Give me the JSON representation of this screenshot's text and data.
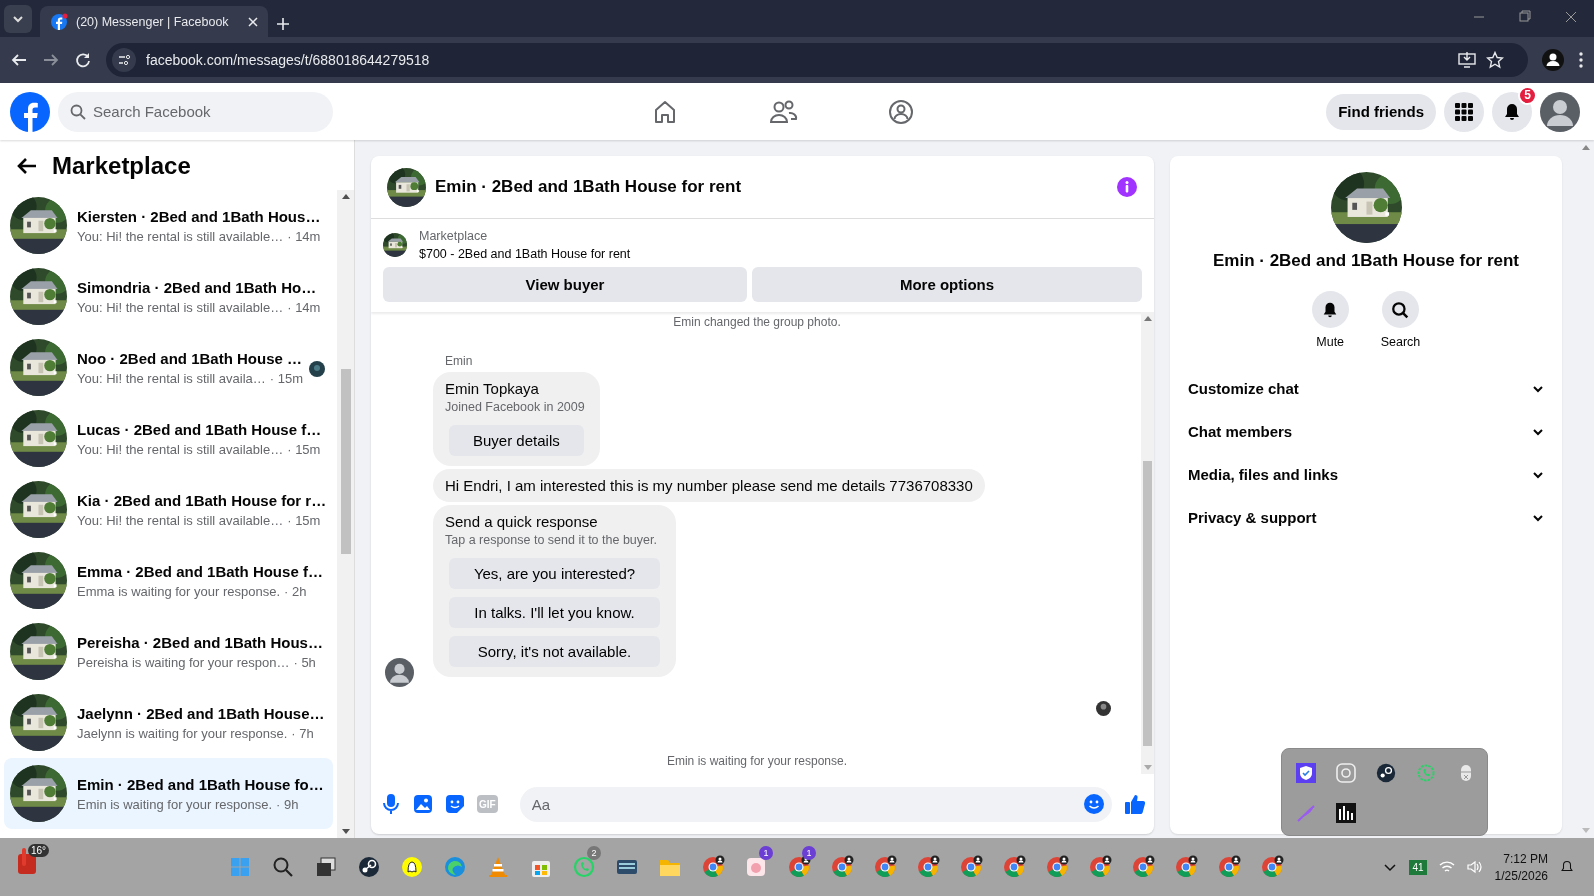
{
  "browser": {
    "tab_title": "(20) Messenger | Facebook",
    "url": "facebook.com/messages/t/688018644279518"
  },
  "header": {
    "search_placeholder": "Search Facebook",
    "find_friends": "Find friends",
    "notification_count": "5"
  },
  "sidebar": {
    "title": "Marketplace",
    "chats": [
      {
        "title": "Kiersten · 2Bed and 1Bath Hous…",
        "preview": "You: Hi! the rental is still available…",
        "time": "· 14m",
        "selected": false,
        "seen": false
      },
      {
        "title": "Simondria · 2Bed and 1Bath Ho…",
        "preview": "You: Hi! the rental is still available…",
        "time": "· 14m",
        "selected": false,
        "seen": false
      },
      {
        "title": "Noo · 2Bed and 1Bath House …",
        "preview": "You: Hi! the rental is still availa…",
        "time": "· 15m",
        "selected": false,
        "seen": true
      },
      {
        "title": "Lucas · 2Bed and 1Bath House f…",
        "preview": "You: Hi! the rental is still available…",
        "time": "· 15m",
        "selected": false,
        "seen": false
      },
      {
        "title": "Kia · 2Bed and 1Bath House for r…",
        "preview": "You: Hi! the rental is still available…",
        "time": "· 15m",
        "selected": false,
        "seen": false
      },
      {
        "title": "Emma · 2Bed and 1Bath House f…",
        "preview": "Emma is waiting for your response.",
        "time": "· 2h",
        "selected": false,
        "seen": false
      },
      {
        "title": "Pereisha · 2Bed and 1Bath Hous…",
        "preview": "Pereisha is waiting for your respon…",
        "time": "· 5h",
        "selected": false,
        "seen": false
      },
      {
        "title": "Jaelynn · 2Bed and 1Bath House…",
        "preview": "Jaelynn is waiting for your response.",
        "time": "· 7h",
        "selected": false,
        "seen": false
      },
      {
        "title": "Emin · 2Bed and 1Bath House fo…",
        "preview": "Emin is waiting for your response.",
        "time": "· 9h",
        "selected": true,
        "seen": false
      }
    ]
  },
  "chat": {
    "title": "Emin · 2Bed and 1Bath House for rent",
    "listing": {
      "label": "Marketplace",
      "price_title": "$700 - 2Bed and 1Bath House for rent",
      "buttons": [
        "View buyer",
        "More options"
      ]
    },
    "system_top": "Emin changed the group photo.",
    "sender": "Emin",
    "buyer_card": {
      "name": "Emin Topkaya",
      "subtitle": "Joined Facebook in 2009",
      "button": "Buyer details"
    },
    "message": "Hi Endri, I am interested this is my number please send me details 7736708330",
    "quick_response": {
      "title": "Send a quick response",
      "subtitle": "Tap a response to send it to the buyer.",
      "options": [
        "Yes, are you interested?",
        "In talks. I'll let you know.",
        "Sorry, it's not available."
      ]
    },
    "system_bottom": "Emin is waiting for your response.",
    "composer": {
      "gif_label": "GIF",
      "placeholder": "Aa"
    }
  },
  "details": {
    "title": "Emin · 2Bed and 1Bath House for rent",
    "actions": [
      "Mute",
      "Search"
    ],
    "sections": [
      "Customize chat",
      "Chat members",
      "Media, files and links",
      "Privacy & support"
    ]
  },
  "taskbar": {
    "weather": "16°",
    "apps": [
      {
        "kind": "windows"
      },
      {
        "kind": "search"
      },
      {
        "kind": "taskview"
      },
      {
        "kind": "steam"
      },
      {
        "kind": "snapchat"
      },
      {
        "kind": "edge"
      },
      {
        "kind": "vlc"
      },
      {
        "kind": "store"
      },
      {
        "kind": "whatsapp",
        "badge": "2"
      },
      {
        "kind": "keyboard"
      },
      {
        "kind": "folder"
      },
      {
        "kind": "chrome"
      },
      {
        "kind": "notes",
        "badge": "1"
      },
      {
        "kind": "chrome",
        "badge": "1"
      },
      {
        "kind": "chrome"
      },
      {
        "kind": "chrome"
      },
      {
        "kind": "chrome"
      },
      {
        "kind": "chrome"
      },
      {
        "kind": "chrome"
      },
      {
        "kind": "chrome"
      },
      {
        "kind": "chrome"
      },
      {
        "kind": "chrome"
      },
      {
        "kind": "chrome"
      },
      {
        "kind": "chrome"
      },
      {
        "kind": "chrome"
      }
    ],
    "tray_badge": "41",
    "time": "7:12 PM",
    "date": "1/25/2026"
  }
}
